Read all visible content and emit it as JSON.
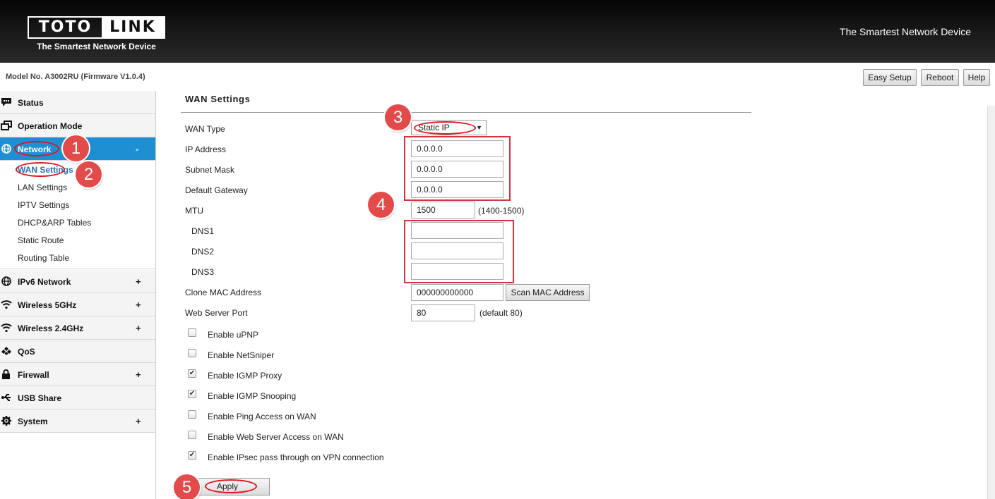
{
  "header": {
    "logo_left": "TOTO",
    "logo_right": "LINK",
    "logo_subtitle": "The Smartest Network Device",
    "tagline": "The Smartest Network Device"
  },
  "model_bar": {
    "model": "Model No. A3002RU (Firmware V1.0.4)",
    "buttons": {
      "easy_setup": "Easy Setup",
      "reboot": "Reboot",
      "help": "Help"
    }
  },
  "sidebar": {
    "items": [
      {
        "label": "Status",
        "icon": "chat-icon",
        "toggle": ""
      },
      {
        "label": "Operation Mode",
        "icon": "windows-icon",
        "toggle": ""
      },
      {
        "label": "Network",
        "icon": "globe-icon",
        "toggle": "-"
      },
      {
        "label": "IPv6 Network",
        "icon": "globe-icon",
        "toggle": "+"
      },
      {
        "label": "Wireless 5GHz",
        "icon": "wifi-icon",
        "toggle": "+"
      },
      {
        "label": "Wireless 2.4GHz",
        "icon": "wifi-icon",
        "toggle": "+"
      },
      {
        "label": "QoS",
        "icon": "qos-icon",
        "toggle": ""
      },
      {
        "label": "Firewall",
        "icon": "lock-icon",
        "toggle": "+"
      },
      {
        "label": "USB Share",
        "icon": "usb-icon",
        "toggle": ""
      },
      {
        "label": "System",
        "icon": "gear-icon",
        "toggle": "+"
      }
    ],
    "network_subitems": [
      "WAN Settings",
      "LAN Settings",
      "IPTV Settings",
      "DHCP&ARP Tables",
      "Static Route",
      "Routing Table"
    ],
    "active_color": "#1f8fd4"
  },
  "content": {
    "title": "WAN Settings",
    "fields": {
      "wan_type": {
        "label": "WAN Type",
        "value": "Static IP"
      },
      "ip_address": {
        "label": "IP Address",
        "value": "0.0.0.0"
      },
      "subnet_mask": {
        "label": "Subnet Mask",
        "value": "0.0.0.0"
      },
      "default_gateway": {
        "label": "Default Gateway",
        "value": "0.0.0.0"
      },
      "mtu": {
        "label": "MTU",
        "value": "1500",
        "hint": "(1400-1500)"
      },
      "dns1": {
        "label": "DNS1",
        "value": ""
      },
      "dns2": {
        "label": "DNS2",
        "value": ""
      },
      "dns3": {
        "label": "DNS3",
        "value": ""
      },
      "clone_mac": {
        "label": "Clone MAC Address",
        "value": "000000000000",
        "button": "Scan MAC Address"
      },
      "web_port": {
        "label": "Web Server Port",
        "value": "80",
        "hint": "(default 80)"
      }
    },
    "checkboxes": [
      {
        "label": "Enable uPNP",
        "checked": false
      },
      {
        "label": "Enable NetSniper",
        "checked": false
      },
      {
        "label": "Enable IGMP Proxy",
        "checked": true
      },
      {
        "label": "Enable IGMP Snooping",
        "checked": true
      },
      {
        "label": "Enable Ping Access on WAN",
        "checked": false
      },
      {
        "label": "Enable Web Server Access on WAN",
        "checked": false
      },
      {
        "label": "Enable IPsec pass through on VPN connection",
        "checked": true
      }
    ],
    "apply": "Apply"
  },
  "annotations": {
    "steps": [
      "1",
      "2",
      "3",
      "4",
      "5"
    ],
    "color": "#e34a4a"
  }
}
